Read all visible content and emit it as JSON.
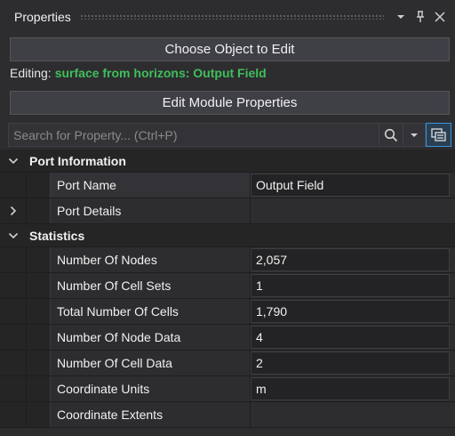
{
  "panel": {
    "title": "Properties",
    "pin_icon": "pin-icon",
    "close_icon": "close-icon",
    "dropdown_icon": "chevron-down-icon"
  },
  "choose_button": "Choose Object to Edit",
  "editing": {
    "label": "Editing:",
    "value": "surface from horizons: Output Field",
    "value_color": "#3fbf5a"
  },
  "edit_module_button": "Edit Module Properties",
  "search": {
    "placeholder": "Search for Property... (Ctrl+P)",
    "value": ""
  },
  "categories": [
    {
      "name": "Port Information",
      "rows": [
        {
          "name": "Port Name",
          "value": "Output Field",
          "expandable": false
        },
        {
          "name": "Port Details",
          "value": "",
          "expandable": true
        }
      ]
    },
    {
      "name": "Statistics",
      "rows": [
        {
          "name": "Number Of Nodes",
          "value": "2,057"
        },
        {
          "name": "Number Of Cell Sets",
          "value": "1"
        },
        {
          "name": "Total Number Of Cells",
          "value": "1,790"
        },
        {
          "name": "Number Of Node Data",
          "value": "4"
        },
        {
          "name": "Number Of Cell Data",
          "value": "2"
        },
        {
          "name": "Coordinate Units",
          "value": "m"
        },
        {
          "name": "Coordinate Extents",
          "value": ""
        }
      ]
    }
  ],
  "colors": {
    "background": "#2d2d30",
    "accent": "#3a96dd"
  }
}
